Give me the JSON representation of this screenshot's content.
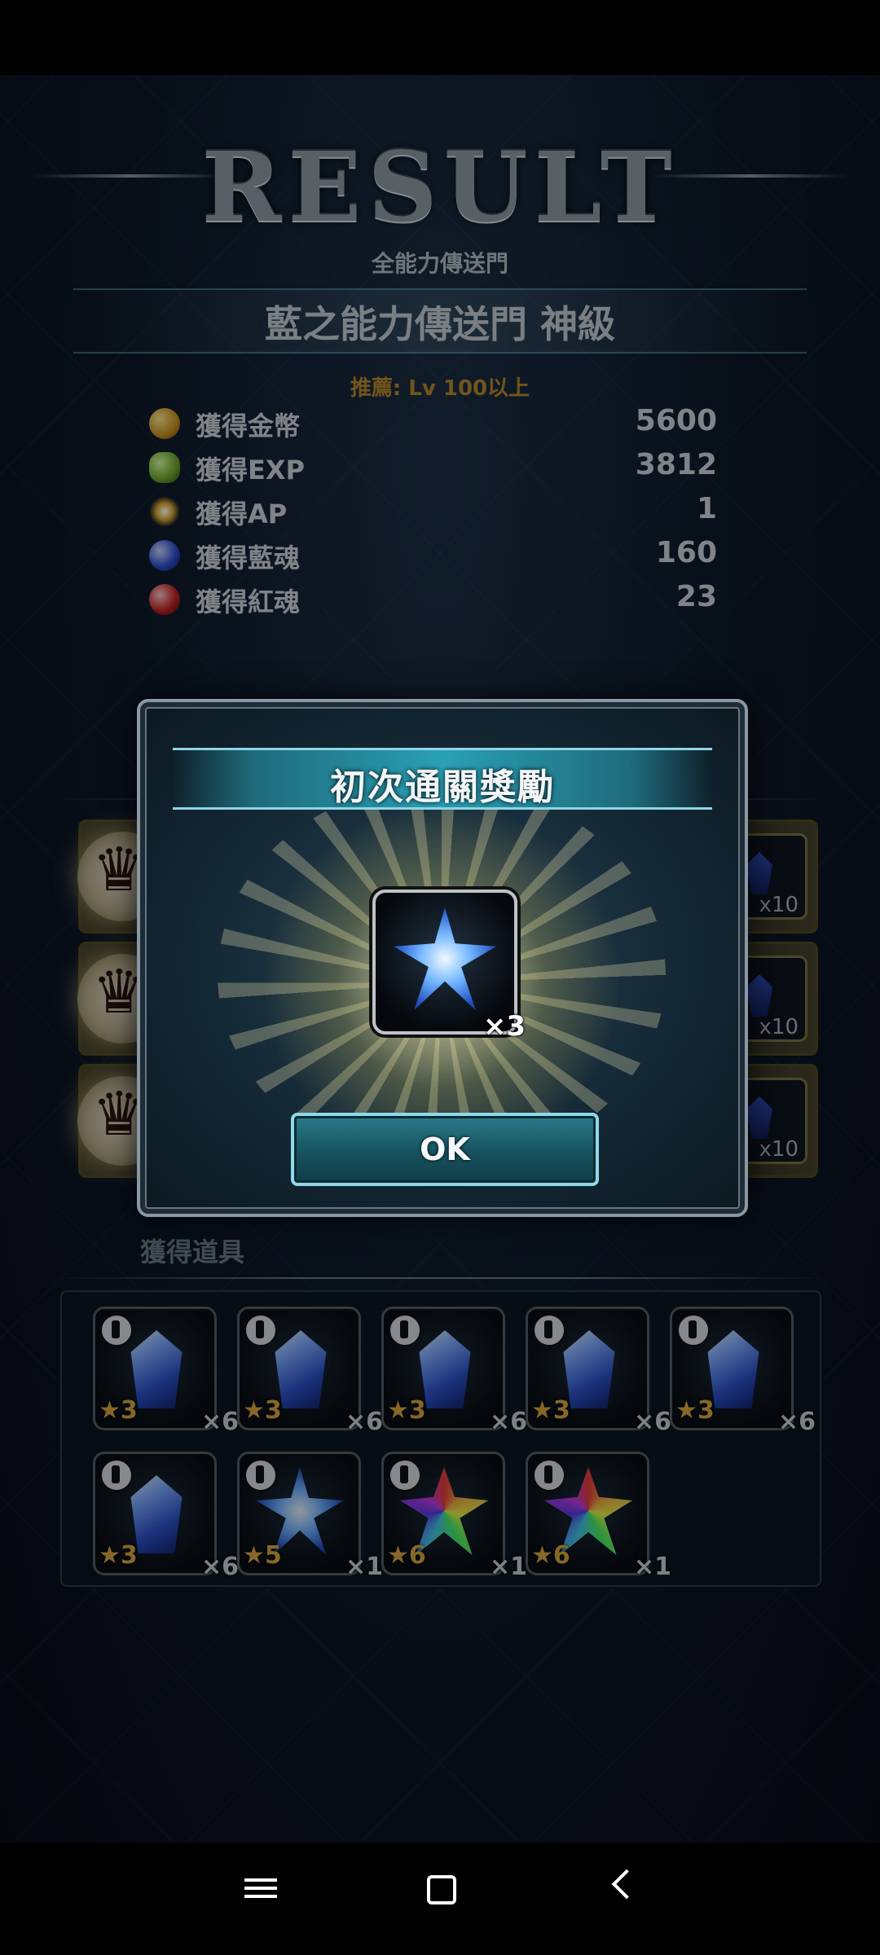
{
  "header": {
    "title": "RESULT",
    "subtitle": "全能力傳送門",
    "stage_name": "藍之能力傳送門 神級",
    "recommend": "推薦: Lv 100以上"
  },
  "stats": [
    {
      "icon": "gold-coin-icon",
      "label": "獲得金幣",
      "value": "5600"
    },
    {
      "icon": "exp-icon",
      "label": "獲得EXP",
      "value": "3812"
    },
    {
      "icon": "ap-icon",
      "label": "獲得AP",
      "value": "1"
    },
    {
      "icon": "blue-soul-icon",
      "label": "獲得藍魂",
      "value": "160"
    },
    {
      "icon": "red-soul-icon",
      "label": "獲得紅魂",
      "value": "23"
    }
  ],
  "first_clear_rows": [
    {
      "count": "x10"
    },
    {
      "count": "x10"
    },
    {
      "count": "x10"
    }
  ],
  "items_section": {
    "title": "獲得道具",
    "items": [
      {
        "type": "crystal",
        "stars": "3",
        "count": "×6"
      },
      {
        "type": "crystal",
        "stars": "3",
        "count": "×6"
      },
      {
        "type": "crystal",
        "stars": "3",
        "count": "×6"
      },
      {
        "type": "crystal",
        "stars": "3",
        "count": "×6"
      },
      {
        "type": "crystal",
        "stars": "3",
        "count": "×6"
      },
      {
        "type": "crystal",
        "stars": "3",
        "count": "×6"
      },
      {
        "type": "star-crystal",
        "stars": "5",
        "count": "×1"
      },
      {
        "type": "rainbow-crystal",
        "stars": "6",
        "count": "×1"
      },
      {
        "type": "rainbow-crystal",
        "stars": "6",
        "count": "×1"
      }
    ]
  },
  "modal": {
    "title": "初次通關獎勵",
    "reward_count": "×3",
    "ok_label": "OK"
  },
  "colors": {
    "accent_cyan": "#8fd5e6",
    "gold_text": "#b98a2e",
    "star_gold": "#d9a640"
  }
}
